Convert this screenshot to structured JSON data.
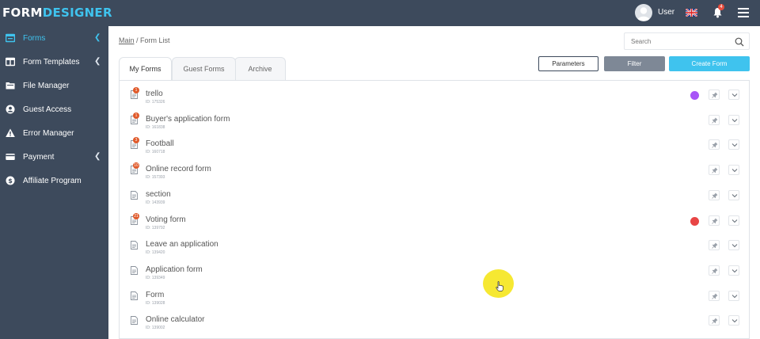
{
  "app": {
    "logo_part1": "FORM",
    "logo_part2": "DESIGNER",
    "user_name": "User",
    "notifications_count": "4",
    "language_icon": "uk-flag-icon"
  },
  "colors": {
    "sidebar_bg": "#3d4a5c",
    "accent": "#3fc3ee",
    "filter_button": "#7e8896",
    "badge": "#e05a2b",
    "status_purple": "#a855f7",
    "status_red": "#e84545",
    "cursor_highlight": "#f5e51c"
  },
  "sidebar": {
    "items": [
      {
        "label": "Forms",
        "icon": "forms-icon",
        "has_submenu": true,
        "active": true
      },
      {
        "label": "Form Templates",
        "icon": "templates-icon",
        "has_submenu": true,
        "active": false
      },
      {
        "label": "File Manager",
        "icon": "folder-icon",
        "has_submenu": false,
        "active": false
      },
      {
        "label": "Guest Access",
        "icon": "user-circle-icon",
        "has_submenu": false,
        "active": false
      },
      {
        "label": "Error Manager",
        "icon": "warning-icon",
        "has_submenu": false,
        "active": false
      },
      {
        "label": "Payment",
        "icon": "card-icon",
        "has_submenu": true,
        "active": false
      },
      {
        "label": "Affiliate Program",
        "icon": "dollar-icon",
        "has_submenu": false,
        "active": false
      }
    ]
  },
  "breadcrumb": {
    "root": "Main",
    "separator": " / ",
    "current": "Form List"
  },
  "search": {
    "placeholder": "Search",
    "value": ""
  },
  "tabs": [
    {
      "label": "My Forms",
      "active": true
    },
    {
      "label": "Guest Forms",
      "active": false
    },
    {
      "label": "Archive",
      "active": false
    }
  ],
  "toolbar": {
    "parameters_label": "Parameters",
    "filter_label": "Filter",
    "create_label": "Create Form"
  },
  "forms": [
    {
      "name": "trello",
      "id_text": "ID: 175326",
      "badge": "1",
      "status_color": "#a855f7"
    },
    {
      "name": "Buyer's application form",
      "id_text": "ID: 161838",
      "badge": "1",
      "status_color": null
    },
    {
      "name": "Football",
      "id_text": "ID: 160718",
      "badge": "3",
      "status_color": null
    },
    {
      "name": "Online record form",
      "id_text": "ID: 157393",
      "badge": "10",
      "status_color": null
    },
    {
      "name": "section",
      "id_text": "ID: 143939",
      "badge": null,
      "status_color": null
    },
    {
      "name": "Voting form",
      "id_text": "ID: 139792",
      "badge": "21",
      "status_color": "#e84545"
    },
    {
      "name": "Leave an application",
      "id_text": "ID: 139420",
      "badge": null,
      "status_color": null
    },
    {
      "name": "Application form",
      "id_text": "ID: 139349",
      "badge": null,
      "status_color": null
    },
    {
      "name": "Form",
      "id_text": "ID: 139028",
      "badge": null,
      "status_color": null
    },
    {
      "name": "Online calculator",
      "id_text": "ID: 139002",
      "badge": null,
      "status_color": null
    }
  ]
}
